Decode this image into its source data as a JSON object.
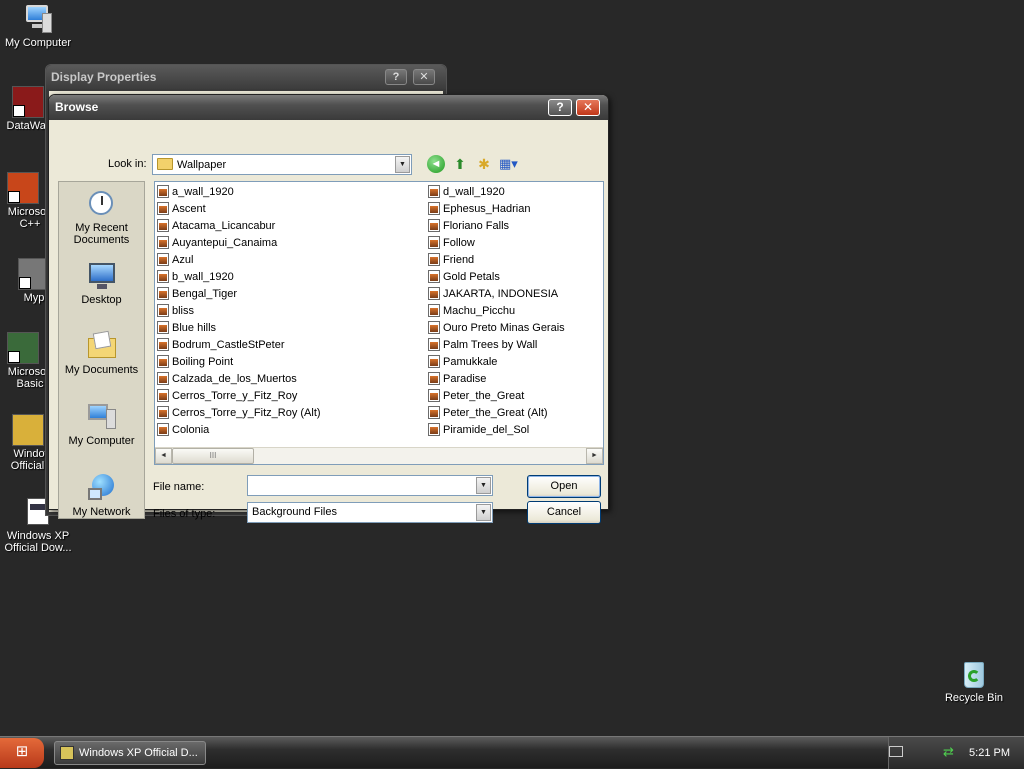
{
  "desktop": {
    "icons": [
      {
        "label": "My Computer"
      },
      {
        "label": "DataWar"
      },
      {
        "label": "Microsoft C++"
      },
      {
        "label": "Myp"
      },
      {
        "label": "Microsoft Basic"
      },
      {
        "label": "Window Official D"
      },
      {
        "label": "Windows XP Official Dow..."
      },
      {
        "label": "Recycle Bin"
      }
    ]
  },
  "background_window": {
    "title": "Display Properties",
    "help_label": "?",
    "close_label": "✕"
  },
  "dialog": {
    "title": "Browse",
    "help_label": "?",
    "close_label": "✕",
    "look_in_label": "Look in:",
    "look_in_value": "Wallpaper",
    "places": [
      {
        "label": "My Recent Documents"
      },
      {
        "label": "Desktop"
      },
      {
        "label": "My Documents"
      },
      {
        "label": "My Computer"
      },
      {
        "label": "My Network"
      }
    ],
    "files_col1": [
      "a_wall_1920",
      "Ascent",
      "Atacama_Licancabur",
      "Auyantepui_Canaima",
      "Azul",
      "b_wall_1920",
      "Bengal_Tiger",
      "bliss",
      "Blue hills",
      "Bodrum_CastleStPeter",
      "Boiling Point",
      "Calzada_de_los_Muertos",
      "Cerros_Torre_y_Fitz_Roy",
      "Cerros_Torre_y_Fitz_Roy (Alt)",
      "Colonia"
    ],
    "files_col2": [
      "d_wall_1920",
      "Ephesus_Hadrian",
      "Floriano Falls",
      "Follow",
      "Friend",
      "Gold Petals",
      "JAKARTA, INDONESIA",
      "Machu_Picchu",
      "Ouro Preto Minas Gerais",
      "Palm Trees by Wall",
      "Pamukkale",
      "Paradise",
      "Peter_the_Great",
      "Peter_the_Great (Alt)",
      "Piramide_del_Sol"
    ],
    "scroll_thumb": "III",
    "file_name_label": "File name:",
    "file_name_value": "",
    "file_type_label": "Files of type:",
    "file_type_value": "Background Files",
    "open_label": "Open",
    "cancel_label": "Cancel"
  },
  "taskbar": {
    "task_label": "Windows XP Official D...",
    "clock": "5:21 PM"
  }
}
